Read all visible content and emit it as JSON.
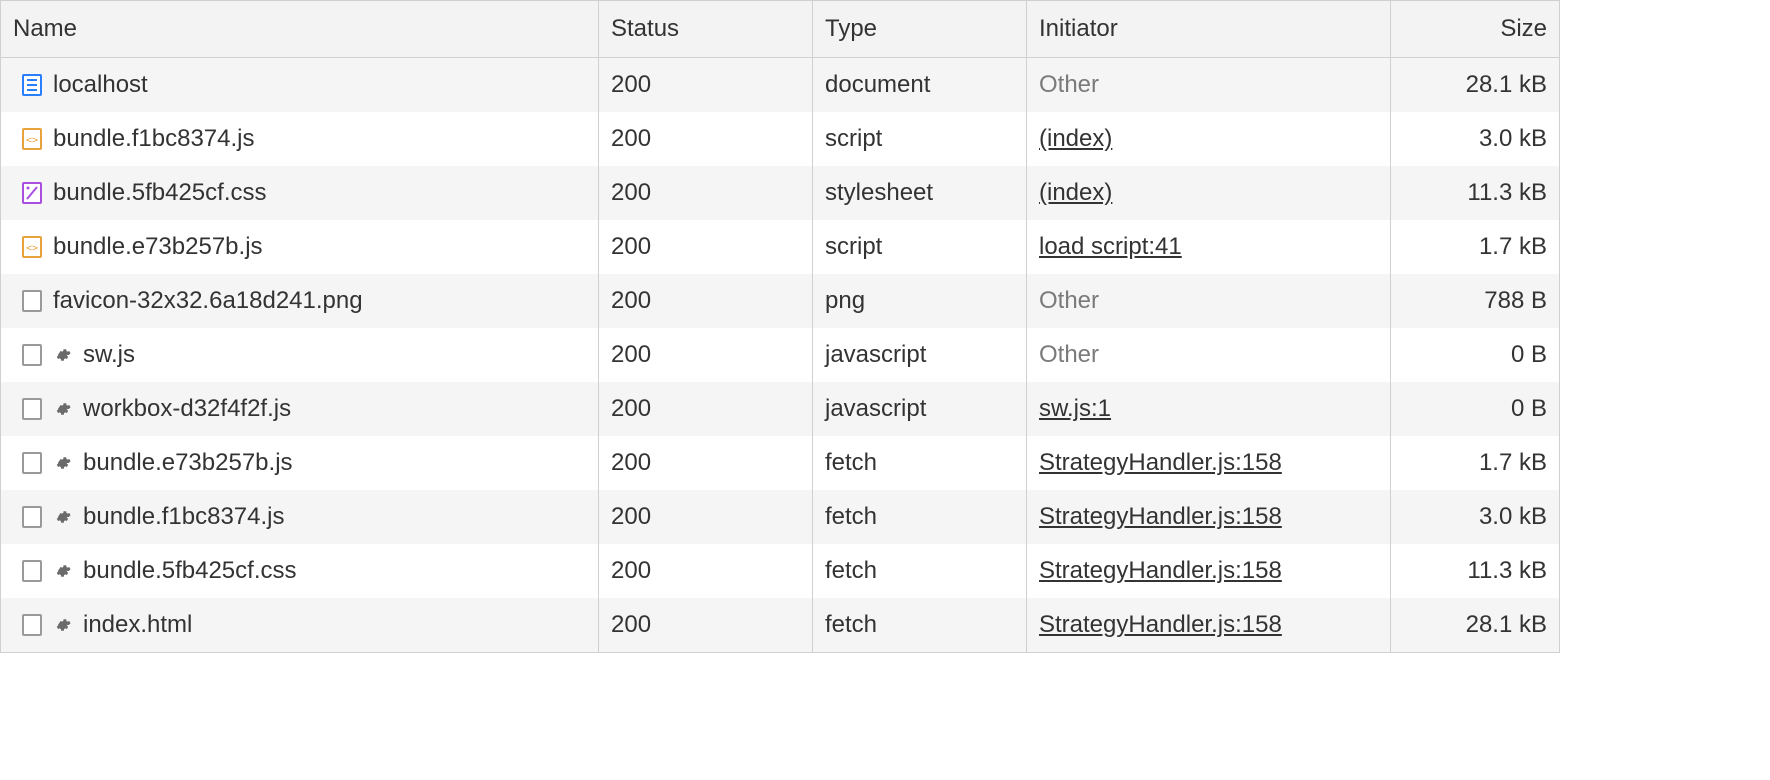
{
  "columns": {
    "name": "Name",
    "status": "Status",
    "type": "Type",
    "initiator": "Initiator",
    "size": "Size"
  },
  "rows": [
    {
      "icon": "document",
      "gear": false,
      "name": "localhost",
      "status": "200",
      "type": "document",
      "initiator": "Other",
      "initiator_link": false,
      "size": "28.1 kB"
    },
    {
      "icon": "js",
      "gear": false,
      "name": "bundle.f1bc8374.js",
      "status": "200",
      "type": "script",
      "initiator": "(index)",
      "initiator_link": true,
      "size": "3.0 kB"
    },
    {
      "icon": "css",
      "gear": false,
      "name": "bundle.5fb425cf.css",
      "status": "200",
      "type": "stylesheet",
      "initiator": "(index)",
      "initiator_link": true,
      "size": "11.3 kB"
    },
    {
      "icon": "js",
      "gear": false,
      "name": "bundle.e73b257b.js",
      "status": "200",
      "type": "script",
      "initiator": "load script:41",
      "initiator_link": true,
      "size": "1.7 kB"
    },
    {
      "icon": "blank",
      "gear": false,
      "name": "favicon-32x32.6a18d241.png",
      "status": "200",
      "type": "png",
      "initiator": "Other",
      "initiator_link": false,
      "size": "788 B"
    },
    {
      "icon": "blank",
      "gear": true,
      "name": "sw.js",
      "status": "200",
      "type": "javascript",
      "initiator": "Other",
      "initiator_link": false,
      "size": "0 B"
    },
    {
      "icon": "blank",
      "gear": true,
      "name": "workbox-d32f4f2f.js",
      "status": "200",
      "type": "javascript",
      "initiator": "sw.js:1",
      "initiator_link": true,
      "size": "0 B"
    },
    {
      "icon": "blank",
      "gear": true,
      "name": "bundle.e73b257b.js",
      "status": "200",
      "type": "fetch",
      "initiator": "StrategyHandler.js:158",
      "initiator_link": true,
      "size": "1.7 kB"
    },
    {
      "icon": "blank",
      "gear": true,
      "name": "bundle.f1bc8374.js",
      "status": "200",
      "type": "fetch",
      "initiator": "StrategyHandler.js:158",
      "initiator_link": true,
      "size": "3.0 kB"
    },
    {
      "icon": "blank",
      "gear": true,
      "name": "bundle.5fb425cf.css",
      "status": "200",
      "type": "fetch",
      "initiator": "StrategyHandler.js:158",
      "initiator_link": true,
      "size": "11.3 kB"
    },
    {
      "icon": "blank",
      "gear": true,
      "name": "index.html",
      "status": "200",
      "type": "fetch",
      "initiator": "StrategyHandler.js:158",
      "initiator_link": true,
      "size": "28.1 kB"
    }
  ]
}
